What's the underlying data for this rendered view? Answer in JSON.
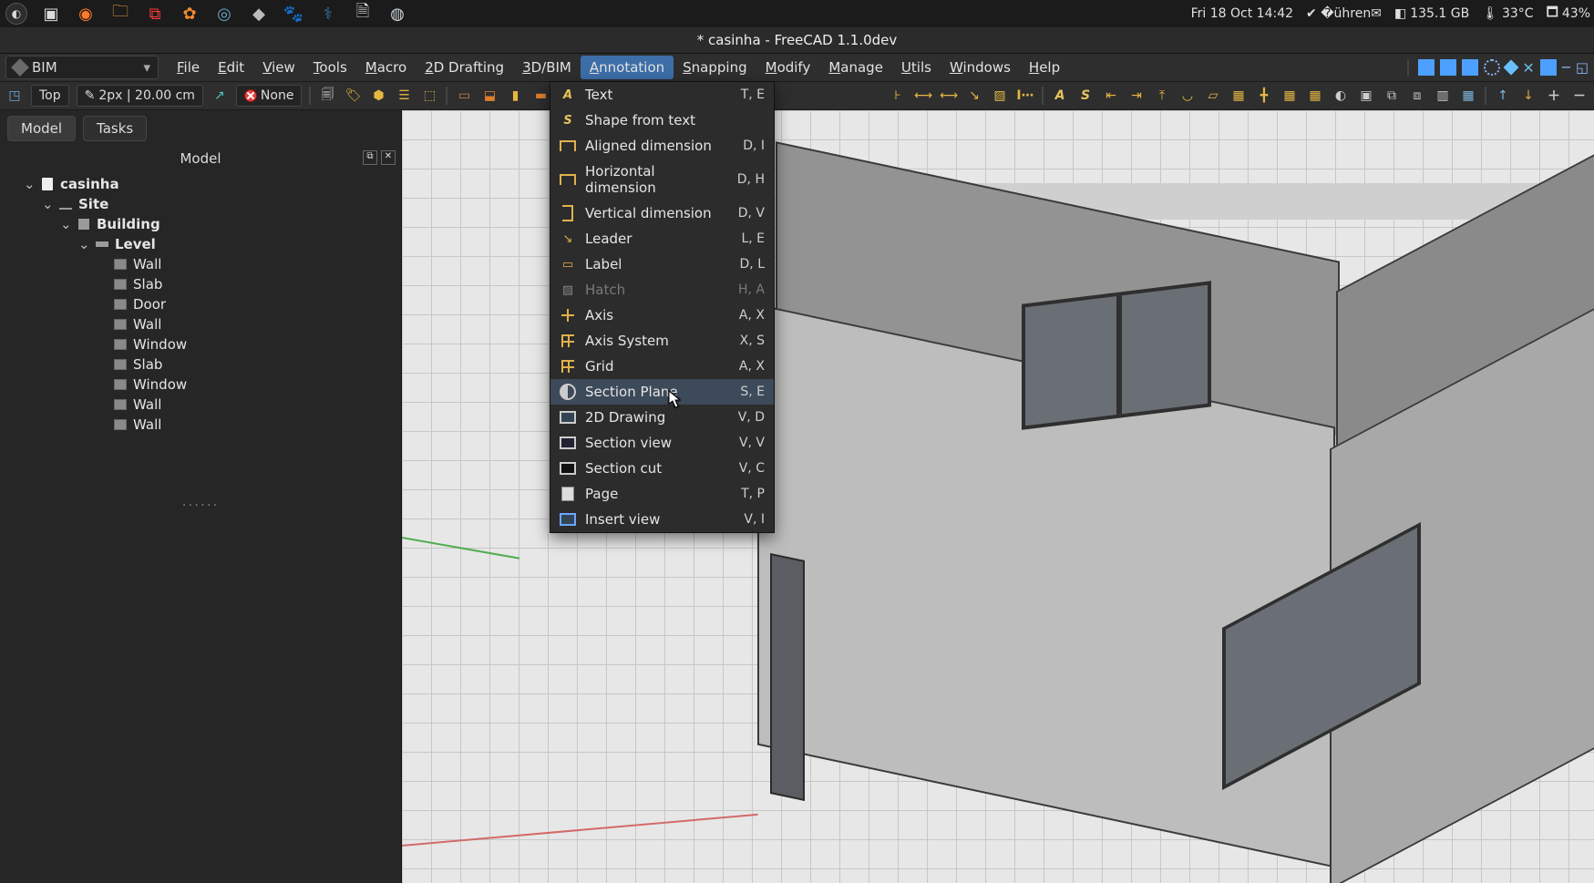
{
  "os_bar": {
    "datetime": "Fri 18 Oct  14:42",
    "disk": "135.1 GB",
    "temp": "33°C",
    "battery": "43%"
  },
  "window": {
    "title": "* casinha - FreeCAD 1.1.0dev"
  },
  "workbench": {
    "name": "BIM"
  },
  "menus": {
    "items": [
      "File",
      "Edit",
      "View",
      "Tools",
      "Macro",
      "2D Drafting",
      "3D/BIM",
      "Annotation",
      "Snapping",
      "Modify",
      "Manage",
      "Utils",
      "Windows",
      "Help"
    ],
    "active": "Annotation"
  },
  "toolbar": {
    "top_chip": "Top",
    "px_chip": "2px | 20.00 cm",
    "none_chip": "None"
  },
  "tabs": {
    "model": "Model",
    "tasks": "Tasks"
  },
  "panel": {
    "title": "Model",
    "ellipsis": "......"
  },
  "tree": {
    "root": {
      "name": "casinha",
      "children": [
        {
          "name": "Site",
          "children": [
            {
              "name": "Building",
              "children": [
                {
                  "name": "Level",
                  "children": [
                    {
                      "name": "Wall"
                    },
                    {
                      "name": "Slab"
                    },
                    {
                      "name": "Door"
                    },
                    {
                      "name": "Wall"
                    },
                    {
                      "name": "Window"
                    },
                    {
                      "name": "Slab"
                    },
                    {
                      "name": "Window"
                    },
                    {
                      "name": "Wall"
                    },
                    {
                      "name": "Wall"
                    }
                  ]
                }
              ]
            }
          ]
        }
      ]
    }
  },
  "dropdown": {
    "items": [
      {
        "label": "Text",
        "shortcut": "T, E"
      },
      {
        "label": "Shape from text",
        "shortcut": ""
      },
      {
        "label": "Aligned dimension",
        "shortcut": "D, I"
      },
      {
        "label": "Horizontal dimension",
        "shortcut": "D, H"
      },
      {
        "label": "Vertical dimension",
        "shortcut": "D, V"
      },
      {
        "label": "Leader",
        "shortcut": "L, E"
      },
      {
        "label": "Label",
        "shortcut": "D, L"
      },
      {
        "label": "Hatch",
        "shortcut": "H, A",
        "disabled": true
      },
      {
        "label": "Axis",
        "shortcut": "A, X"
      },
      {
        "label": "Axis System",
        "shortcut": "X, S"
      },
      {
        "label": "Grid",
        "shortcut": "A, X"
      },
      {
        "label": "Section Plane",
        "shortcut": "S, E",
        "hover": true
      },
      {
        "label": "2D Drawing",
        "shortcut": "V, D"
      },
      {
        "label": "Section view",
        "shortcut": "V, V"
      },
      {
        "label": "Section cut",
        "shortcut": "V, C"
      },
      {
        "label": "Page",
        "shortcut": "T, P"
      },
      {
        "label": "Insert view",
        "shortcut": "V, I"
      }
    ]
  }
}
